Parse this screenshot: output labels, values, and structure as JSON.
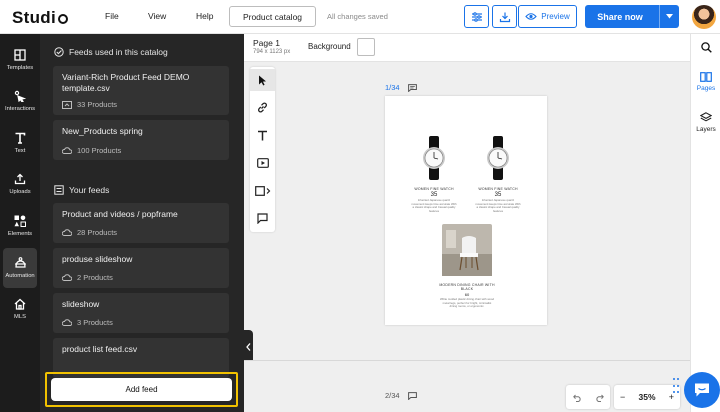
{
  "app": {
    "logo": "Studi"
  },
  "menu": {
    "file": "File",
    "view": "View",
    "help": "Help"
  },
  "toolbar": {
    "catalog_label": "Product catalog",
    "saved_status": "All changes saved",
    "preview_label": "Preview",
    "share_label": "Share now",
    "colors": {
      "accent": "#1a73e8",
      "highlight": "#f2c200"
    }
  },
  "rail": {
    "items": [
      {
        "label": "Templates",
        "icon": "templates-icon"
      },
      {
        "label": "Interactions",
        "icon": "interactions-icon"
      },
      {
        "label": "Text",
        "icon": "text-icon"
      },
      {
        "label": "Uploads",
        "icon": "uploads-icon"
      },
      {
        "label": "Elements",
        "icon": "elements-icon"
      },
      {
        "label": "Automation",
        "icon": "automation-icon"
      },
      {
        "label": "MLS",
        "icon": "mls-icon"
      }
    ]
  },
  "feeds_panel": {
    "catalog_heading": "Feeds used in this catalog",
    "catalog_feeds": [
      {
        "name": "Variant-Rich Product Feed DEMO template.csv",
        "count": "33 Products"
      },
      {
        "name": "New_Products spring",
        "count": "100 Products"
      }
    ],
    "your_feeds_heading": "Your feeds",
    "your_feeds": [
      {
        "name": "Product and videos / popframe",
        "count": "28 Products"
      },
      {
        "name": "produse slideshow",
        "count": "2 Products"
      },
      {
        "name": "slideshow",
        "count": "3 Products"
      },
      {
        "name": "product list feed.csv",
        "count": ""
      }
    ],
    "add_feed_label": "Add feed"
  },
  "canvas": {
    "page_title": "Page 1",
    "page_size": "794 x 1123 px",
    "background_label": "Background",
    "page1_indicator": "1/34",
    "page2_indicator": "2/34",
    "products": [
      {
        "name": "WOMEN FINE WATCH",
        "price": "35",
        "desc": "Inherited Japanese quartz movement keeps time accurate With a classic shape and Casual quality features"
      },
      {
        "name": "WOMEN FINE WATCH",
        "price": "35",
        "desc": "Inherited Japanese quartz movement keeps time accurate With a classic shape and Casual quality features"
      },
      {
        "name": "MODERN DINING CHAIR WITH BLACK",
        "price": "60",
        "desc": "White molded plastic dining chair with wood metal legs, perfect for bright, minimalist dining rooms, or ergonomic."
      }
    ]
  },
  "zoom": {
    "value": "35%",
    "minus": "−",
    "plus": "+"
  },
  "right_panel": {
    "pages_label": "Pages",
    "layers_label": "Layers"
  }
}
